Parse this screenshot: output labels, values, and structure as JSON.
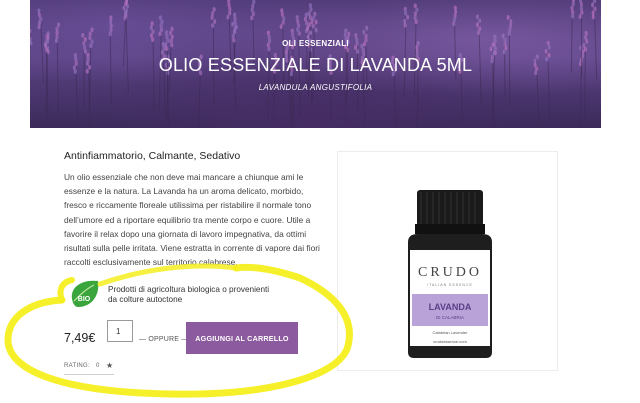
{
  "hero": {
    "category": "OLI ESSENZIALI",
    "title": "OLIO ESSENZIALE DI LAVANDA 5ML",
    "latin_name": "LAVANDULA ANGUSTIFOLIA"
  },
  "product": {
    "subtitle": "Antinfiammatorio, Calmante, Sedativo",
    "description": "Un olio essenziale che non deve mai mancare a chiunque ami le essenze e la natura. La Lavanda ha un aroma delicato, morbido, fresco e riccamente floreale utilissima per ristabilire il normale tono dell’umore ed a riportare equilibrio tra mente corpo e cuore. Utile a favorire il relax dopo una giornata di lavoro impegnativa, da ottimi risultati sulla pelle irritata. Viene estratta in corrente di vapore dai fiori raccolti esclusivamente sul territorio calabrese.",
    "bio_badge": "BIO",
    "bio_text": "Prodotti di agricoltura biologica o provenienti da colture autoctone",
    "price": "7,49€",
    "quantity": "1",
    "or_label": "— OPPURE —",
    "add_to_cart": "AGGIUNGI AL CARRELLO",
    "rating_label": "RATING:",
    "rating_value": "0"
  },
  "bottle_label": {
    "brand": "CRUDO",
    "brand_sub": "ITALIAN ESSENCE",
    "name": "LAVANDA",
    "region": "DI CALABRIA",
    "variety": "Calabrian Lavender",
    "url": "crudoessence.com"
  },
  "colors": {
    "accent": "#8c5a9e",
    "highlight": "#f5ef1f",
    "bio_green": "#3aa53c"
  }
}
